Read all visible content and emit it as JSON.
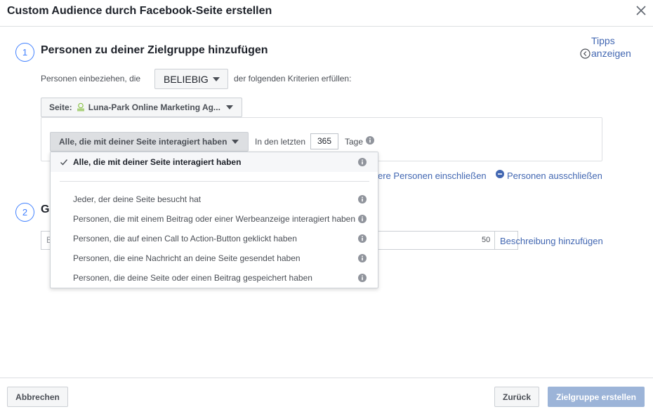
{
  "dialog": {
    "title": "Custom Audience durch Facebook-Seite erstellen",
    "close_icon": "close-icon"
  },
  "tips": {
    "line1": "Tipps",
    "line2": "anzeigen",
    "icon": "chevron-left-circle-icon"
  },
  "step1": {
    "number": "1",
    "title": "Personen zu deiner Zielgruppe hinzufügen",
    "include_prefix": "Personen einbeziehen, die",
    "match_value": "BELIEBIG",
    "include_suffix": "der folgenden Kriterien erfüllen:",
    "page_label": "Seite:",
    "page_name": "Luna-Park Online Marketing Ag...",
    "criteria_value": "Alle, die mit deiner Seite interagiert haben",
    "in_last_label": "In den letzten",
    "days_value": "365",
    "days_unit": "Tage",
    "include_more_link": "ere Personen einschließen",
    "exclude_link": "Personen ausschließen"
  },
  "step2": {
    "number": "2",
    "title_visible": "G",
    "name_placeholder_visible": "B",
    "char_counter": "50",
    "description_link": "Beschreibung hinzufügen"
  },
  "dropdown": {
    "selected": "Alle, die mit deiner Seite interagiert haben",
    "options": [
      "Jeder, der deine Seite besucht hat",
      "Personen, die mit einem Beitrag oder einer Werbeanzeige interagiert haben",
      "Personen, die auf einen Call to Action-Button geklickt haben",
      "Personen, die eine Nachricht an deine Seite gesendet haben",
      "Personen, die deine Seite oder einen Beitrag gespeichert haben"
    ]
  },
  "footer": {
    "cancel": "Abbrechen",
    "back": "Zurück",
    "create": "Zielgruppe erstellen"
  },
  "colors": {
    "accent": "#4080ff",
    "link": "#4267b2",
    "primary_disabled": "#9cb4d8"
  }
}
